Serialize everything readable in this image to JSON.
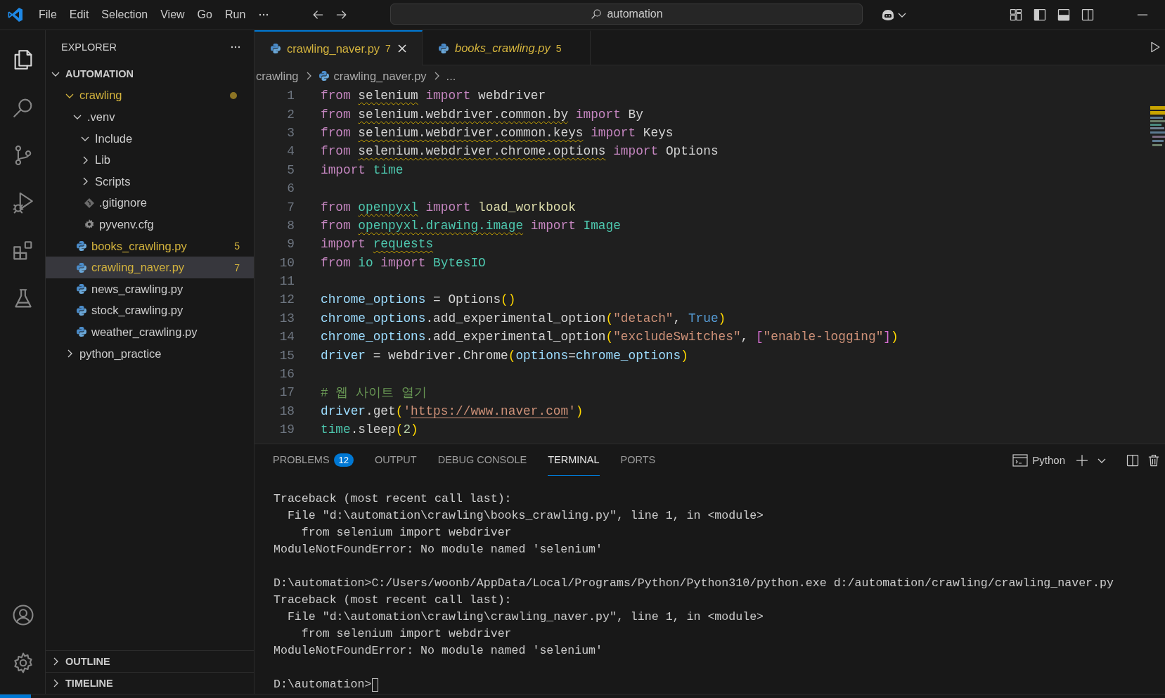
{
  "title_bar": {
    "menu": [
      "File",
      "Edit",
      "Selection",
      "View",
      "Go",
      "Run"
    ],
    "search": {
      "value": "automation"
    }
  },
  "activity_bar": {
    "items": [
      {
        "kind": "explorer",
        "selected": true
      },
      {
        "kind": "search",
        "selected": false
      },
      {
        "kind": "source-control",
        "selected": false
      },
      {
        "kind": "run-debug",
        "selected": false
      },
      {
        "kind": "extensions",
        "selected": false
      },
      {
        "kind": "testing",
        "selected": false
      }
    ],
    "bottom": [
      {
        "kind": "account"
      },
      {
        "kind": "settings"
      }
    ]
  },
  "sidebar": {
    "title": "EXPLORER",
    "root": {
      "label": "AUTOMATION",
      "expanded": true,
      "children": [
        {
          "label": "crawling",
          "kind": "folder",
          "expanded": true,
          "modified": true,
          "selected": false,
          "children": [
            {
              "label": ".venv",
              "kind": "folder",
              "expanded": true,
              "modified": false,
              "selected": false,
              "children": [
                {
                  "label": "Include",
                  "kind": "folder",
                  "expanded": true,
                  "modified": false,
                  "selected": false
                },
                {
                  "label": "Lib",
                  "kind": "folder",
                  "expanded": false,
                  "modified": false,
                  "selected": false
                },
                {
                  "label": "Scripts",
                  "kind": "folder",
                  "expanded": false,
                  "modified": false,
                  "selected": false
                },
                {
                  "label": ".gitignore",
                  "kind": "git",
                  "modified": false,
                  "selected": false
                },
                {
                  "label": "pyvenv.cfg",
                  "kind": "config",
                  "modified": false,
                  "selected": false
                }
              ]
            },
            {
              "label": "books_crawling.py",
              "kind": "python",
              "modified": true,
              "selected": false,
              "badge": "5"
            },
            {
              "label": "crawling_naver.py",
              "kind": "python",
              "modified": true,
              "selected": true,
              "badge": "7"
            },
            {
              "label": "news_crawling.py",
              "kind": "python",
              "modified": false,
              "selected": false
            },
            {
              "label": "stock_crawling.py",
              "kind": "python",
              "modified": false,
              "selected": false
            },
            {
              "label": "weather_crawling.py",
              "kind": "python",
              "modified": false,
              "selected": false
            }
          ]
        },
        {
          "label": "python_practice",
          "kind": "folder",
          "expanded": false,
          "modified": false,
          "selected": false
        }
      ]
    },
    "sections": [
      {
        "label": "OUTLINE",
        "expanded": false
      },
      {
        "label": "TIMELINE",
        "expanded": false
      }
    ]
  },
  "editor": {
    "tabs": [
      {
        "label": "crawling_naver.py",
        "badge": "7",
        "selected": true,
        "preview": false
      },
      {
        "label": "books_crawling.py",
        "badge": "5",
        "selected": false,
        "preview": true
      }
    ],
    "breadcrumb": [
      {
        "label": "crawling",
        "kind": "folder"
      },
      {
        "label": "crawling_naver.py",
        "kind": "python"
      },
      {
        "label": "...",
        "kind": "symbol"
      }
    ],
    "lines": [
      {
        "number": "1",
        "tokens": [
          {
            "t": "from ",
            "kind": "kw"
          },
          {
            "t": "selenium",
            "kind": "plain",
            "warn": true
          },
          {
            "t": " import ",
            "kind": "kw"
          },
          {
            "t": "webdriver",
            "kind": "plain"
          }
        ]
      },
      {
        "number": "2",
        "tokens": [
          {
            "t": "from ",
            "kind": "kw"
          },
          {
            "t": "selenium.webdriver.common.by",
            "kind": "plain",
            "warn": true
          },
          {
            "t": " import ",
            "kind": "kw"
          },
          {
            "t": "By",
            "kind": "plain"
          }
        ]
      },
      {
        "number": "3",
        "tokens": [
          {
            "t": "from ",
            "kind": "kw"
          },
          {
            "t": "selenium.webdriver.common.keys",
            "kind": "plain",
            "warn": true
          },
          {
            "t": " import ",
            "kind": "kw"
          },
          {
            "t": "Keys",
            "kind": "plain"
          }
        ]
      },
      {
        "number": "4",
        "tokens": [
          {
            "t": "from ",
            "kind": "kw"
          },
          {
            "t": "selenium.webdriver.chrome.options",
            "kind": "plain",
            "warn": true
          },
          {
            "t": " import ",
            "kind": "kw"
          },
          {
            "t": "Options",
            "kind": "plain"
          }
        ]
      },
      {
        "number": "5",
        "tokens": [
          {
            "t": "import ",
            "kind": "kw"
          },
          {
            "t": "time",
            "kind": "mod"
          }
        ]
      },
      {
        "number": "6"
      },
      {
        "number": "7",
        "tokens": [
          {
            "t": "from ",
            "kind": "kw"
          },
          {
            "t": "openpyxl",
            "kind": "mod",
            "warn": true
          },
          {
            "t": " import ",
            "kind": "kw"
          },
          {
            "t": "load_workbook",
            "kind": "fn"
          }
        ]
      },
      {
        "number": "8",
        "tokens": [
          {
            "t": "from ",
            "kind": "kw"
          },
          {
            "t": "openpyxl.drawing.image",
            "kind": "mod",
            "warn": true
          },
          {
            "t": " import ",
            "kind": "kw"
          },
          {
            "t": "Image",
            "kind": "mod"
          }
        ]
      },
      {
        "number": "9",
        "tokens": [
          {
            "t": "import ",
            "kind": "kw"
          },
          {
            "t": "requests",
            "kind": "mod",
            "warn": true
          }
        ]
      },
      {
        "number": "10",
        "tokens": [
          {
            "t": "from ",
            "kind": "kw"
          },
          {
            "t": "io",
            "kind": "mod"
          },
          {
            "t": " import ",
            "kind": "kw"
          },
          {
            "t": "BytesIO",
            "kind": "mod"
          }
        ]
      },
      {
        "number": "11"
      },
      {
        "number": "12",
        "tokens": [
          {
            "t": "chrome_options",
            "kind": "var"
          },
          {
            "t": " = Options",
            "kind": "plain"
          },
          {
            "t": "()",
            "kind": "br1"
          }
        ]
      },
      {
        "number": "13",
        "tokens": [
          {
            "t": "chrome_options",
            "kind": "var"
          },
          {
            "t": ".add_experimental_option",
            "kind": "plain"
          },
          {
            "t": "(",
            "kind": "br1"
          },
          {
            "t": "\"detach\"",
            "kind": "str"
          },
          {
            "t": ", ",
            "kind": "plain"
          },
          {
            "t": "True",
            "kind": "const"
          },
          {
            "t": ")",
            "kind": "br1"
          }
        ]
      },
      {
        "number": "14",
        "tokens": [
          {
            "t": "chrome_options",
            "kind": "var"
          },
          {
            "t": ".add_experimental_option",
            "kind": "plain"
          },
          {
            "t": "(",
            "kind": "br1"
          },
          {
            "t": "\"excludeSwitches\"",
            "kind": "str"
          },
          {
            "t": ", ",
            "kind": "plain"
          },
          {
            "t": "[",
            "kind": "br2"
          },
          {
            "t": "\"enable-logging\"",
            "kind": "str"
          },
          {
            "t": "]",
            "kind": "br2"
          },
          {
            "t": ")",
            "kind": "br1"
          }
        ]
      },
      {
        "number": "15",
        "tokens": [
          {
            "t": "driver",
            "kind": "var"
          },
          {
            "t": " = webdriver.Chrome",
            "kind": "plain"
          },
          {
            "t": "(",
            "kind": "br1"
          },
          {
            "t": "options",
            "kind": "var"
          },
          {
            "t": "=",
            "kind": "plain"
          },
          {
            "t": "chrome_options",
            "kind": "var"
          },
          {
            "t": ")",
            "kind": "br1"
          }
        ]
      },
      {
        "number": "16"
      },
      {
        "number": "17",
        "tokens": [
          {
            "t": "# 웹 사이트 열기",
            "kind": "cmt"
          }
        ]
      },
      {
        "number": "18",
        "tokens": [
          {
            "t": "driver",
            "kind": "var"
          },
          {
            "t": ".get",
            "kind": "plain"
          },
          {
            "t": "(",
            "kind": "br1"
          },
          {
            "t": "'",
            "kind": "str"
          },
          {
            "t": "https://www.naver.com",
            "kind": "str",
            "link": true
          },
          {
            "t": "'",
            "kind": "str"
          },
          {
            "t": ")",
            "kind": "br1"
          }
        ]
      },
      {
        "number": "19",
        "tokens": [
          {
            "t": "time",
            "kind": "mod"
          },
          {
            "t": ".sleep",
            "kind": "plain"
          },
          {
            "t": "(",
            "kind": "br1"
          },
          {
            "t": "2",
            "kind": "num"
          },
          {
            "t": ")",
            "kind": "br1"
          }
        ]
      }
    ]
  },
  "panel": {
    "tabs": [
      {
        "label": "PROBLEMS",
        "badge": "12",
        "selected": false
      },
      {
        "label": "OUTPUT",
        "selected": false
      },
      {
        "label": "DEBUG CONSOLE",
        "selected": false
      },
      {
        "label": "TERMINAL",
        "selected": true
      },
      {
        "label": "PORTS",
        "selected": false
      }
    ],
    "profile": "Python",
    "terminal": {
      "cursor": true,
      "blocks": [
        {
          "lines": [
            "Traceback (most recent call last):",
            "  File \"d:\\automation\\crawling\\books_crawling.py\", line 1, in <module>",
            "    from selenium import webdriver",
            "ModuleNotFoundError: No module named 'selenium'"
          ]
        },
        {
          "lines": [
            "D:\\automation>C:/Users/woonb/AppData/Local/Programs/Python/Python310/python.exe d:/automation/crawling/crawling_naver.py",
            "Traceback (most recent call last):",
            "  File \"d:\\automation\\crawling\\crawling_naver.py\", line 1, in <module>",
            "    from selenium import webdriver",
            "ModuleNotFoundError: No module named 'selenium'"
          ]
        },
        {
          "lines": [
            "D:\\automation>"
          ]
        }
      ]
    }
  }
}
